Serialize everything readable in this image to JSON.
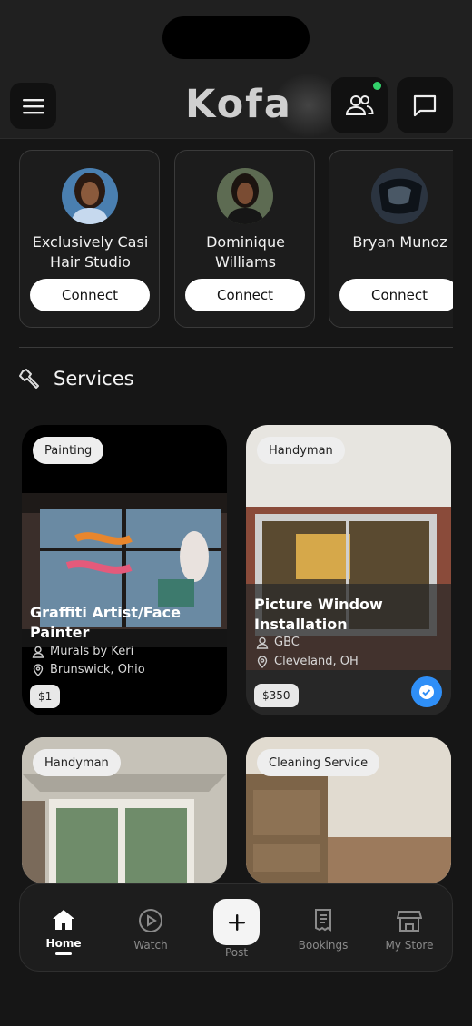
{
  "app": {
    "title": "Kofa"
  },
  "people": [
    {
      "name": "Exclusively Casi Hair Studio",
      "button": "Connect"
    },
    {
      "name": "Dominique Williams",
      "button": "Connect"
    },
    {
      "name": "Bryan Munoz",
      "button": "Connect"
    }
  ],
  "services": {
    "heading": "Services",
    "cards": [
      {
        "category": "Painting",
        "title": "Graffiti Artist/Face Painter",
        "provider": "Murals by Keri",
        "location": "Brunswick, Ohio",
        "price": "$1",
        "verified": false
      },
      {
        "category": "Handyman",
        "title": "Picture Window Installation",
        "provider": "GBC",
        "location": "Cleveland, OH",
        "price": "$350",
        "verified": true
      },
      {
        "category": "Handyman"
      },
      {
        "category": "Cleaning Service"
      }
    ]
  },
  "nav": {
    "home": "Home",
    "watch": "Watch",
    "post": "Post",
    "bookings": "Bookings",
    "store": "My Store"
  },
  "colors": {
    "background": "#161616",
    "online_dot": "#33d16b",
    "verified": "#2f8ff7"
  }
}
